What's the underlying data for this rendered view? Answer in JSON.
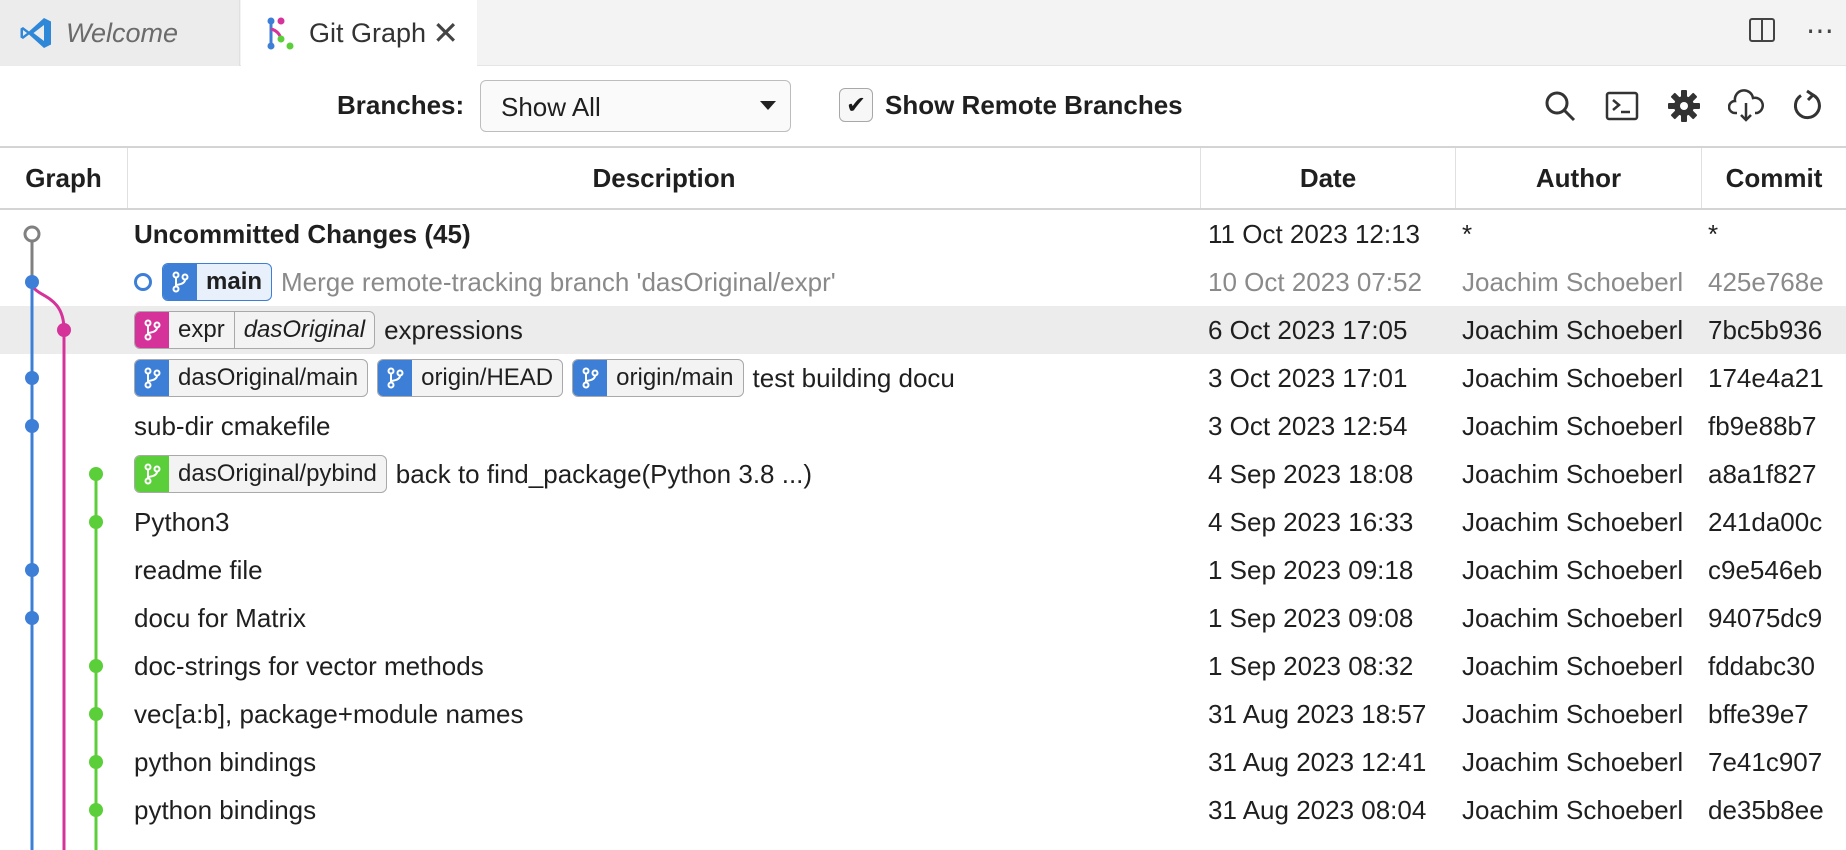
{
  "tabs": [
    {
      "label": "Welcome",
      "active": false
    },
    {
      "label": "Git Graph",
      "active": true
    }
  ],
  "controls": {
    "branches_label": "Branches:",
    "branches_value": "Show All",
    "show_remote_label": "Show Remote Branches",
    "show_remote_checked": true
  },
  "columns": [
    "Graph",
    "Description",
    "Date",
    "Author",
    "Commit"
  ],
  "colors": {
    "main": "#3d7fd6",
    "expr": "#d6339a",
    "pybind": "#5bcf3a",
    "uncommitted": "#808080"
  },
  "commits": [
    {
      "desc": "Uncommitted Changes (45)",
      "refs": [],
      "date": "11 Oct 2023 12:13",
      "author": "*",
      "hash": "*"
    },
    {
      "desc": "Merge remote-tracking branch 'dasOriginal/expr'",
      "refs": [
        {
          "name": "main",
          "color": "#3d7fd6",
          "head": true
        }
      ],
      "date": "10 Oct 2023 07:52",
      "author": "Joachim Schoeberl",
      "hash": "425e768e"
    },
    {
      "desc": "expressions",
      "refs": [
        {
          "name": "expr",
          "remote": "dasOriginal",
          "color": "#d6339a"
        }
      ],
      "date": "6 Oct 2023 17:05",
      "author": "Joachim Schoeberl",
      "hash": "7bc5b936"
    },
    {
      "desc": "test building docu",
      "refs": [
        {
          "name": "dasOriginal/main",
          "color": "#3d7fd6"
        },
        {
          "name": "origin/HEAD",
          "color": "#3d7fd6"
        },
        {
          "name": "origin/main",
          "color": "#3d7fd6"
        }
      ],
      "date": "3 Oct 2023 17:01",
      "author": "Joachim Schoeberl",
      "hash": "174e4a21"
    },
    {
      "desc": "sub-dir cmakefile",
      "refs": [],
      "date": "3 Oct 2023 12:54",
      "author": "Joachim Schoeberl",
      "hash": "fb9e88b7"
    },
    {
      "desc": "back to find_package(Python 3.8 ...)",
      "refs": [
        {
          "name": "dasOriginal/pybind",
          "color": "#5bcf3a"
        }
      ],
      "date": "4 Sep 2023 18:08",
      "author": "Joachim Schoeberl",
      "hash": "a8a1f827"
    },
    {
      "desc": "Python3",
      "refs": [],
      "date": "4 Sep 2023 16:33",
      "author": "Joachim Schoeberl",
      "hash": "241da00c"
    },
    {
      "desc": "readme file",
      "refs": [],
      "date": "1 Sep 2023 09:18",
      "author": "Joachim Schoeberl",
      "hash": "c9e546eb"
    },
    {
      "desc": "docu for Matrix",
      "refs": [],
      "date": "1 Sep 2023 09:08",
      "author": "Joachim Schoeberl",
      "hash": "94075dc9"
    },
    {
      "desc": "doc-strings for vector methods",
      "refs": [],
      "date": "1 Sep 2023 08:32",
      "author": "Joachim Schoeberl",
      "hash": "fddabc30"
    },
    {
      "desc": "vec[a:b], package+module names",
      "refs": [],
      "date": "31 Aug 2023 18:57",
      "author": "Joachim Schoeberl",
      "hash": "bffe39e7"
    },
    {
      "desc": "python bindings",
      "refs": [],
      "date": "31 Aug 2023 12:41",
      "author": "Joachim Schoeberl",
      "hash": "7e41c907"
    },
    {
      "desc": "python bindings",
      "refs": [],
      "date": "31 Aug 2023 08:04",
      "author": "Joachim Schoeberl",
      "hash": "de35b8ee"
    }
  ]
}
